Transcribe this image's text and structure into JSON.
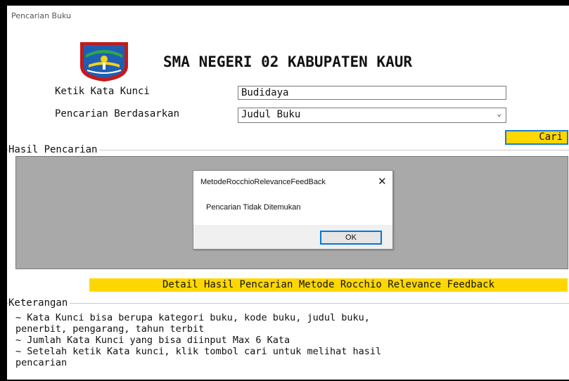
{
  "window": {
    "title": "Pencarian Buku"
  },
  "header": {
    "school_name": "SMA NEGERI 02 KABUPATEN KAUR"
  },
  "form": {
    "keyword_label": "Ketik Kata Kunci",
    "keyword_value": "Budidaya",
    "search_by_label": "Pencarian Berdasarkan",
    "search_by_value": "Judul Buku",
    "search_button": "Cari"
  },
  "results": {
    "group_title": "Hasil Pencarian"
  },
  "dialog": {
    "title": "MetodeRocchioRelevanceFeedBack",
    "close": "✕",
    "message": "Pencarian Tidak Ditemukan",
    "ok_label": "OK"
  },
  "detail_button": "Detail Hasil Pencarian Metode Rocchio Relevance Feedback",
  "notes": {
    "group_title": "Keterangan",
    "lines": [
      "~ Kata Kunci bisa berupa kategori buku, kode buku, judul buku,",
      "penerbit, pengarang, tahun terbit",
      "~ Jumlah Kata Kunci yang bisa diinput Max 6 Kata",
      "~ Setelah ketik Kata kunci, klik tombol cari untuk melihat hasil",
      "pencarian"
    ]
  },
  "colors": {
    "accent_yellow": "#ffd700",
    "focus_blue": "#0078d7",
    "results_gray": "#a9a9a9"
  },
  "icons": {
    "logo": "school-emblem-logo",
    "close": "close-icon",
    "dropdown": "chevron-down-icon"
  }
}
